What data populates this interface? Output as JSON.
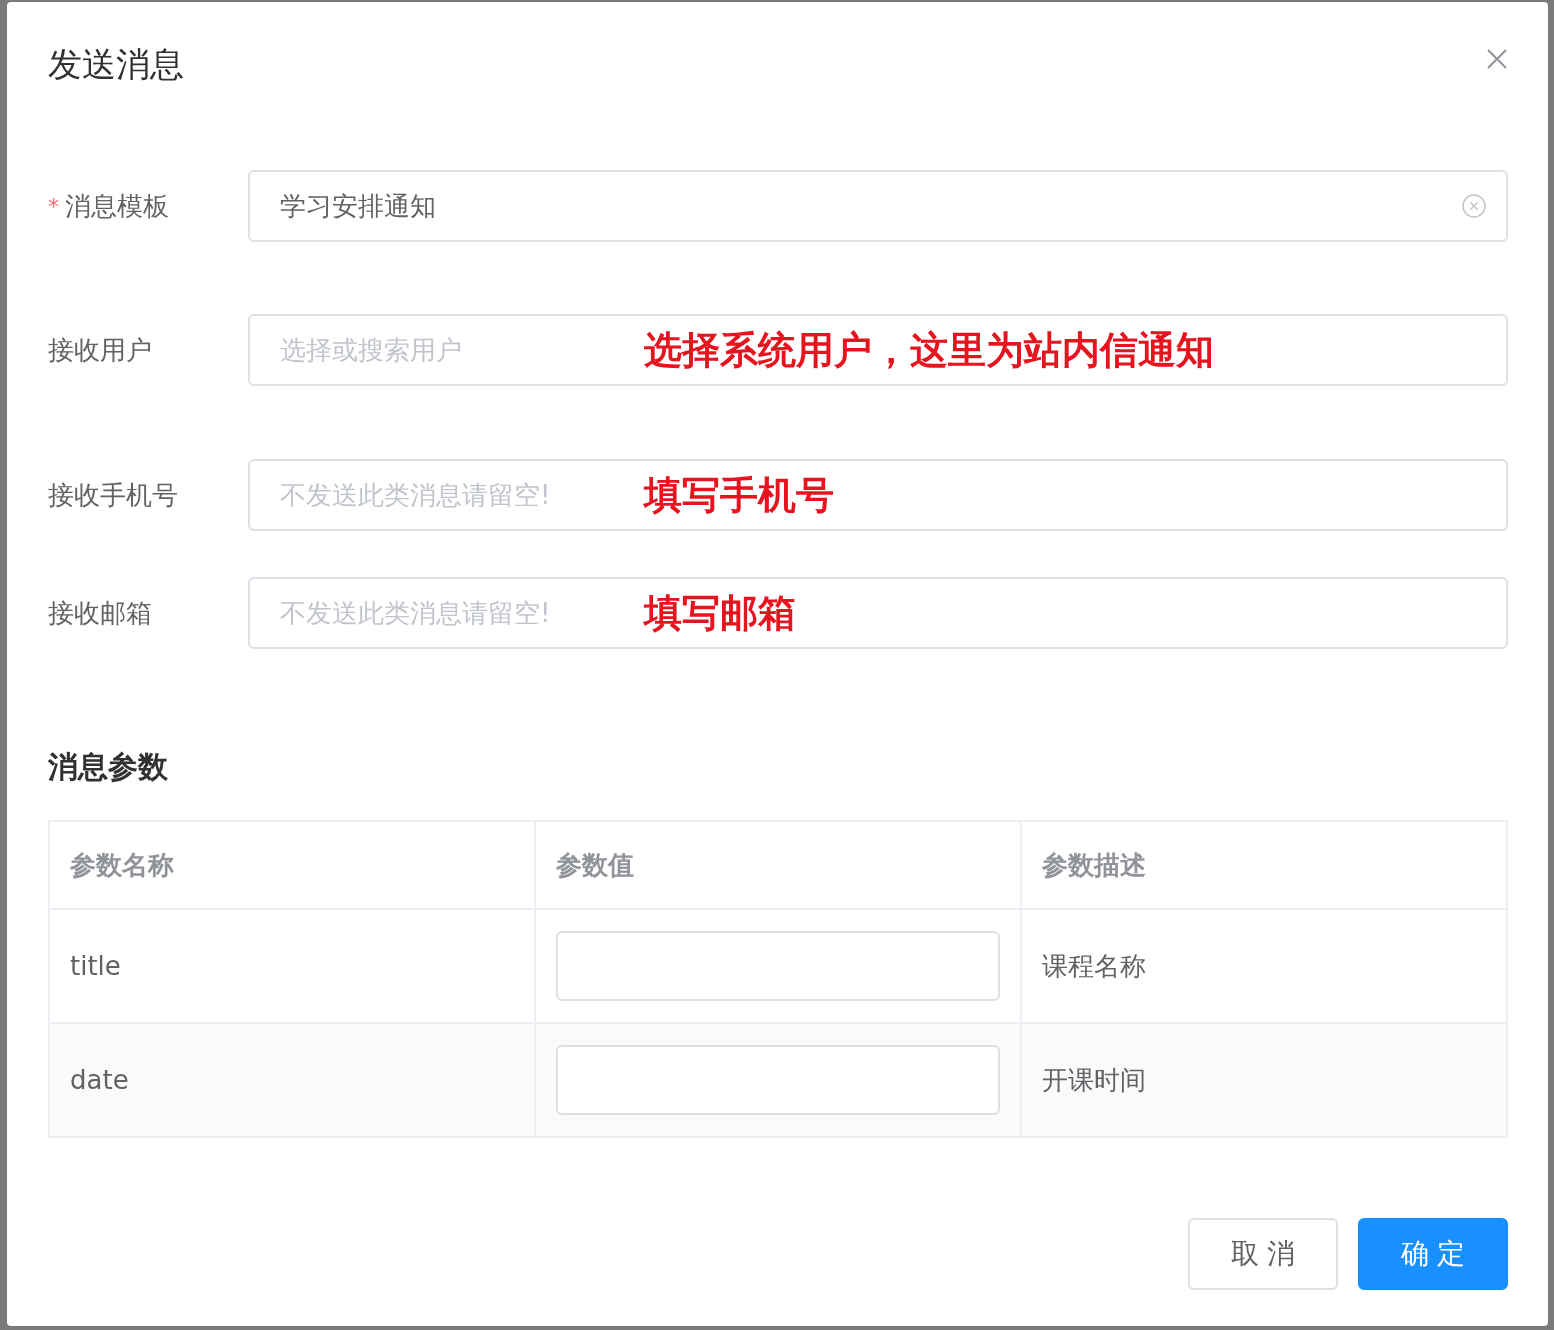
{
  "dialog": {
    "title": "发送消息"
  },
  "fields": [
    {
      "label": "消息模板",
      "required": true,
      "required_mark": "*",
      "value": "学习安排通知",
      "clearable": true
    },
    {
      "label": "接收用户",
      "required": false,
      "placeholder": "选择或搜索用户",
      "clearable": false,
      "annotation": "选择系统用户，这里为站内信通知"
    },
    {
      "label": "接收手机号",
      "required": false,
      "placeholder": "不发送此类消息请留空!",
      "clearable": false,
      "annotation": "填写手机号"
    },
    {
      "label": "接收邮箱",
      "required": false,
      "placeholder": "不发送此类消息请留空!",
      "clearable": false,
      "annotation": "填写邮箱"
    }
  ],
  "params": {
    "heading": "消息参数",
    "columns": [
      "参数名称",
      "参数值",
      "参数描述"
    ],
    "rows": [
      {
        "name": "title",
        "description": "课程名称"
      },
      {
        "name": "date",
        "description": "开课时间"
      }
    ]
  },
  "buttons": [
    {
      "label": "取 消",
      "kind": "default"
    },
    {
      "label": "确 定",
      "kind": "primary"
    }
  ]
}
